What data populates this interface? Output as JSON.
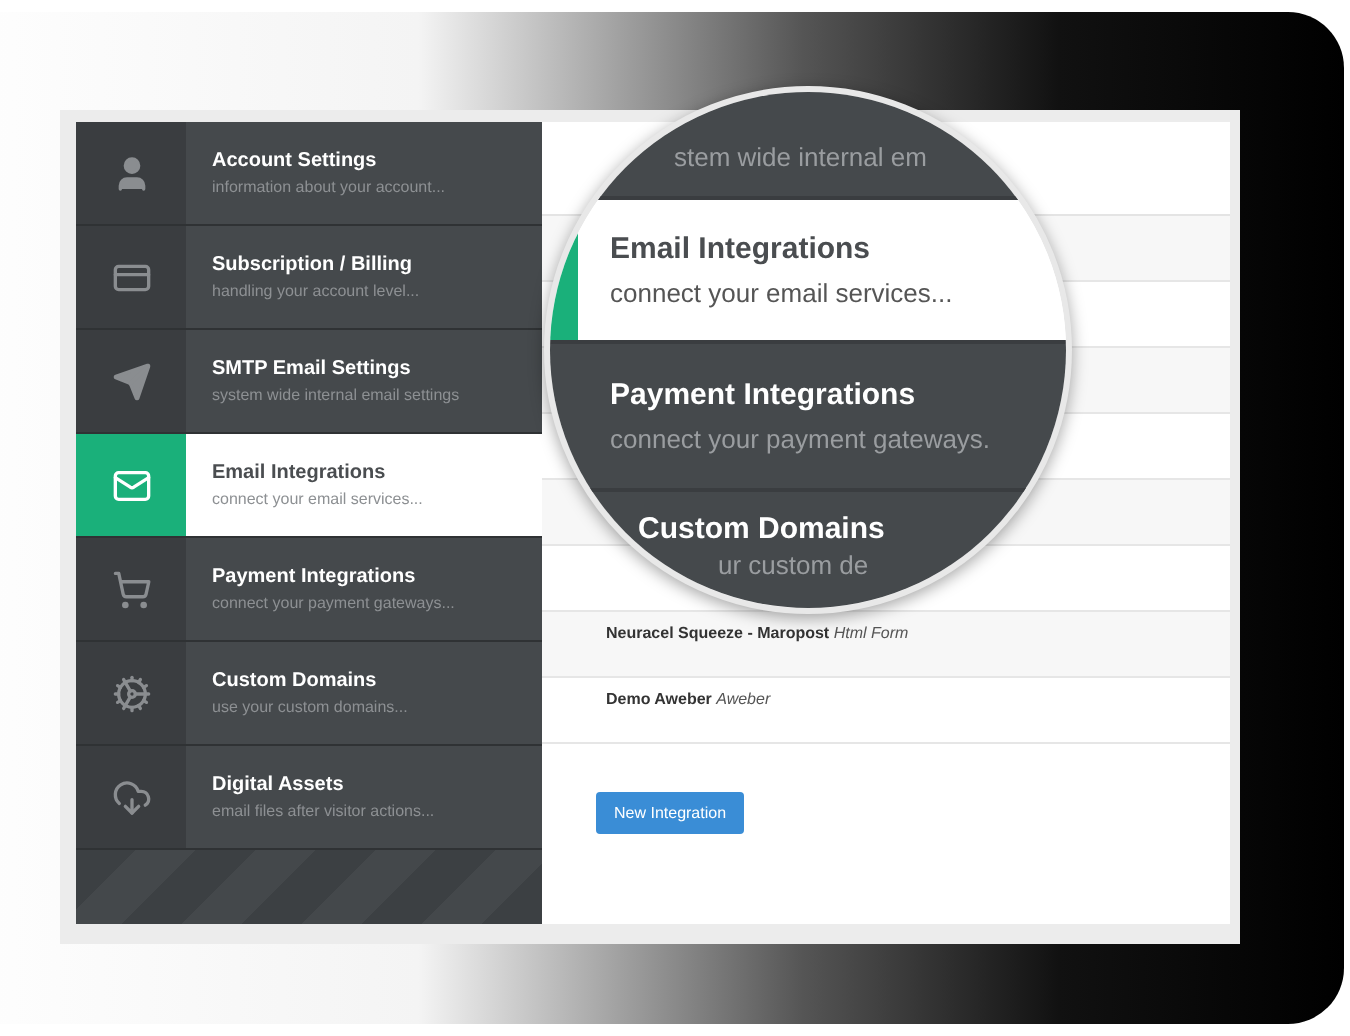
{
  "sidebar": {
    "items": [
      {
        "title": "Account Settings",
        "subtitle": "information about your account...",
        "selected": false
      },
      {
        "title": "Subscription / Billing",
        "subtitle": "handling your account level...",
        "selected": false
      },
      {
        "title": "SMTP Email Settings",
        "subtitle": "system wide internal email settings",
        "selected": false
      },
      {
        "title": "Email Integrations",
        "subtitle": "connect your email services...",
        "selected": true
      },
      {
        "title": "Payment Integrations",
        "subtitle": "connect your payment gateways...",
        "selected": false
      },
      {
        "title": "Custom Domains",
        "subtitle": "use your custom domains...",
        "selected": false
      },
      {
        "title": "Digital Assets",
        "subtitle": "email files after visitor actions...",
        "selected": false
      }
    ]
  },
  "magnifier": {
    "items": [
      {
        "kind": "cut",
        "subtitle": "stem wide internal em",
        "selected": false
      },
      {
        "kind": "full",
        "title": "Email Integrations",
        "subtitle": "connect your email services...",
        "selected": true
      },
      {
        "kind": "full",
        "title": "Payment Integrations",
        "subtitle": "connect your payment gateways.",
        "selected": false
      },
      {
        "kind": "full",
        "title": "Custom Domains",
        "subtitle": "ur custom de",
        "selected": false
      }
    ]
  },
  "integrations": [
    {
      "name": "Neuracel Squeeze - Maropost",
      "type": "Html Form"
    },
    {
      "name": "Demo Aweber",
      "type": "Aweber"
    }
  ],
  "button": "New Integration"
}
